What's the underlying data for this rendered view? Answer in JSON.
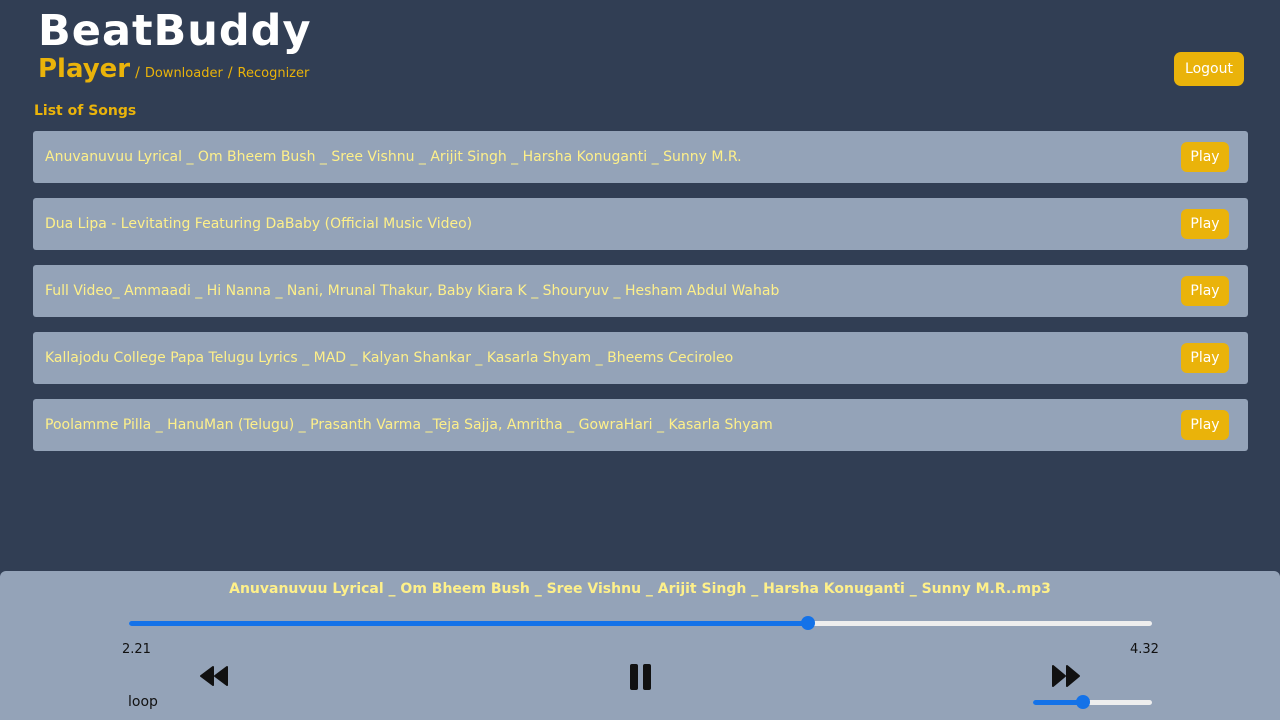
{
  "app": {
    "brand": "BeatBuddy"
  },
  "nav": {
    "active": "Player",
    "separator": "/",
    "links": [
      "Downloader",
      "Recognizer"
    ]
  },
  "header": {
    "logout_label": "Logout"
  },
  "list": {
    "title": "List of Songs",
    "play_label": "Play",
    "songs": [
      "Anuvanuvuu Lyrical _ Om Bheem Bush _ Sree Vishnu _ Arijit Singh _ Harsha Konuganti _ Sunny M.R.",
      "Dua Lipa - Levitating Featuring DaBaby (Official Music Video)",
      "Full Video_ Ammaadi _ Hi Nanna _ Nani, Mrunal Thakur, Baby Kiara K _ Shouryuv _ Hesham Abdul Wahab",
      "Kallajodu College Papa Telugu Lyrics _ MAD _ Kalyan Shankar _ Kasarla Shyam _ Bheems Ceciroleo",
      "Poolamme Pilla _ HanuMan (Telugu) _ Prasanth Varma _Teja Sajja, Amritha _ GowraHari _ Kasarla Shyam"
    ]
  },
  "player": {
    "now_playing": "Anuvanuvuu Lyrical _ Om Bheem Bush _ Sree Vishnu _ Arijit Singh _ Harsha Konuganti _ Sunny M.R..mp3",
    "current_time": "2.21",
    "total_time": "4.32",
    "progress_fraction": 0.664,
    "loop_label": "loop",
    "volume_fraction": 0.42,
    "state": "playing",
    "controls": [
      "rewind-icon",
      "pause-icon",
      "fast-forward-icon"
    ]
  },
  "colors": {
    "background": "#313e54",
    "card": "#94a3b8",
    "accent": "#eab30a",
    "song_text": "#fef08a",
    "slider": "#1472e8"
  }
}
